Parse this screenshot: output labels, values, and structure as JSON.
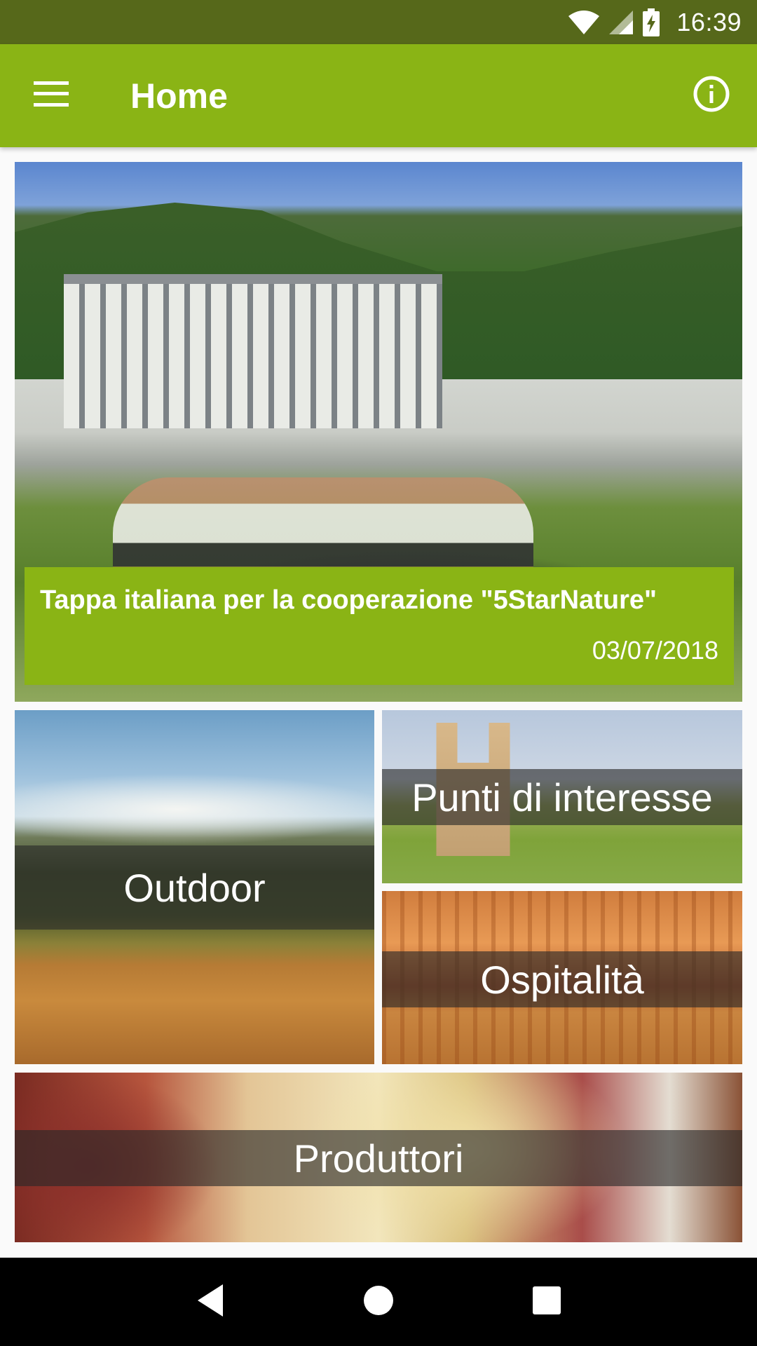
{
  "status_bar": {
    "time": "16:39",
    "icons": [
      "wifi-icon",
      "cell-signal-icon",
      "battery-charging-icon"
    ]
  },
  "app_bar": {
    "title": "Home",
    "menu_icon": "hamburger-menu-icon",
    "info_icon": "info-icon"
  },
  "news": {
    "title": "Tappa italiana per la cooperazione \"5StarNature\"",
    "date": "03/07/2018"
  },
  "tiles": {
    "outdoor": "Outdoor",
    "points_of_interest": "Punti di interesse",
    "hospitality": "Ospitalità",
    "producers": "Produttori"
  },
  "nav_bar": {
    "icons": [
      "back-icon",
      "home-icon",
      "recents-icon"
    ]
  },
  "colors": {
    "status_bar": "#56681a",
    "app_bar": "#8ab415",
    "background": "#fafafa",
    "nav_bar": "#000000"
  }
}
